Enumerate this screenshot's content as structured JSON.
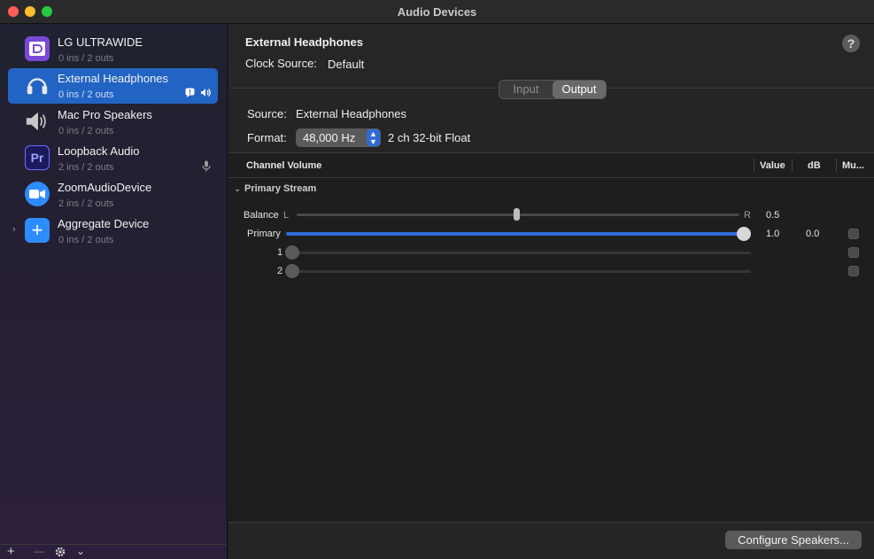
{
  "window": {
    "title": "Audio Devices"
  },
  "sidebar": {
    "devices": [
      {
        "name": "LG ULTRAWIDE",
        "sub": "0 ins / 2 outs",
        "icon": "displayport-icon",
        "icon_color": "#6b3fc9",
        "icon_glyph": "D"
      },
      {
        "name": "External Headphones",
        "sub": "0 ins / 2 outs",
        "icon": "headphones-icon",
        "icon_color": "#2264c4",
        "selected": true
      },
      {
        "name": "Mac Pro Speakers",
        "sub": "0 ins / 2 outs",
        "icon": "speaker-icon",
        "icon_color": "#3a3a3a"
      },
      {
        "name": "Loopback Audio",
        "sub": "2 ins / 2 outs",
        "icon": "premiere-pro-icon",
        "icon_color": "#1c1d5a",
        "icon_glyph": "Pr"
      },
      {
        "name": "ZoomAudioDevice",
        "sub": "2 ins / 2 outs",
        "icon": "zoom-camera-icon",
        "icon_color": "#2d8cff"
      },
      {
        "name": "Aggregate Device",
        "sub": "0 ins / 2 outs",
        "icon": "plus-icon",
        "icon_color": "#2d8cff",
        "icon_glyph": "+"
      }
    ],
    "footer": {
      "add": "+",
      "remove": "—",
      "settings_chevron": "⌄"
    }
  },
  "header": {
    "device_title": "External Headphones",
    "clock_label": "Clock Source:",
    "clock_value": "Default",
    "help": "?"
  },
  "tabs": {
    "input": "Input",
    "output": "Output",
    "selected": "Output"
  },
  "info": {
    "source_label": "Source:",
    "source_value": "External Headphones",
    "format_label": "Format:",
    "format_rate": "48,000 Hz",
    "format_channels": "2 ch 32-bit Float"
  },
  "table": {
    "headers": {
      "channel_volume": "Channel Volume",
      "value": "Value",
      "db": "dB",
      "mute": "Mu..."
    },
    "group": "Primary Stream",
    "balance": {
      "label": "Balance",
      "left": "L",
      "right": "R",
      "value": "0.5",
      "position": 0.5
    },
    "rows": [
      {
        "label": "Primary",
        "value": "1.0",
        "db": "0.0",
        "level": 1.0
      },
      {
        "label": "1",
        "value": "",
        "db": "",
        "level": 0.0
      },
      {
        "label": "2",
        "value": "",
        "db": "",
        "level": 0.0
      }
    ]
  },
  "footer": {
    "configure": "Configure Speakers..."
  },
  "colors": {
    "accent": "#2f6ad8",
    "selection": "#2264c4"
  }
}
